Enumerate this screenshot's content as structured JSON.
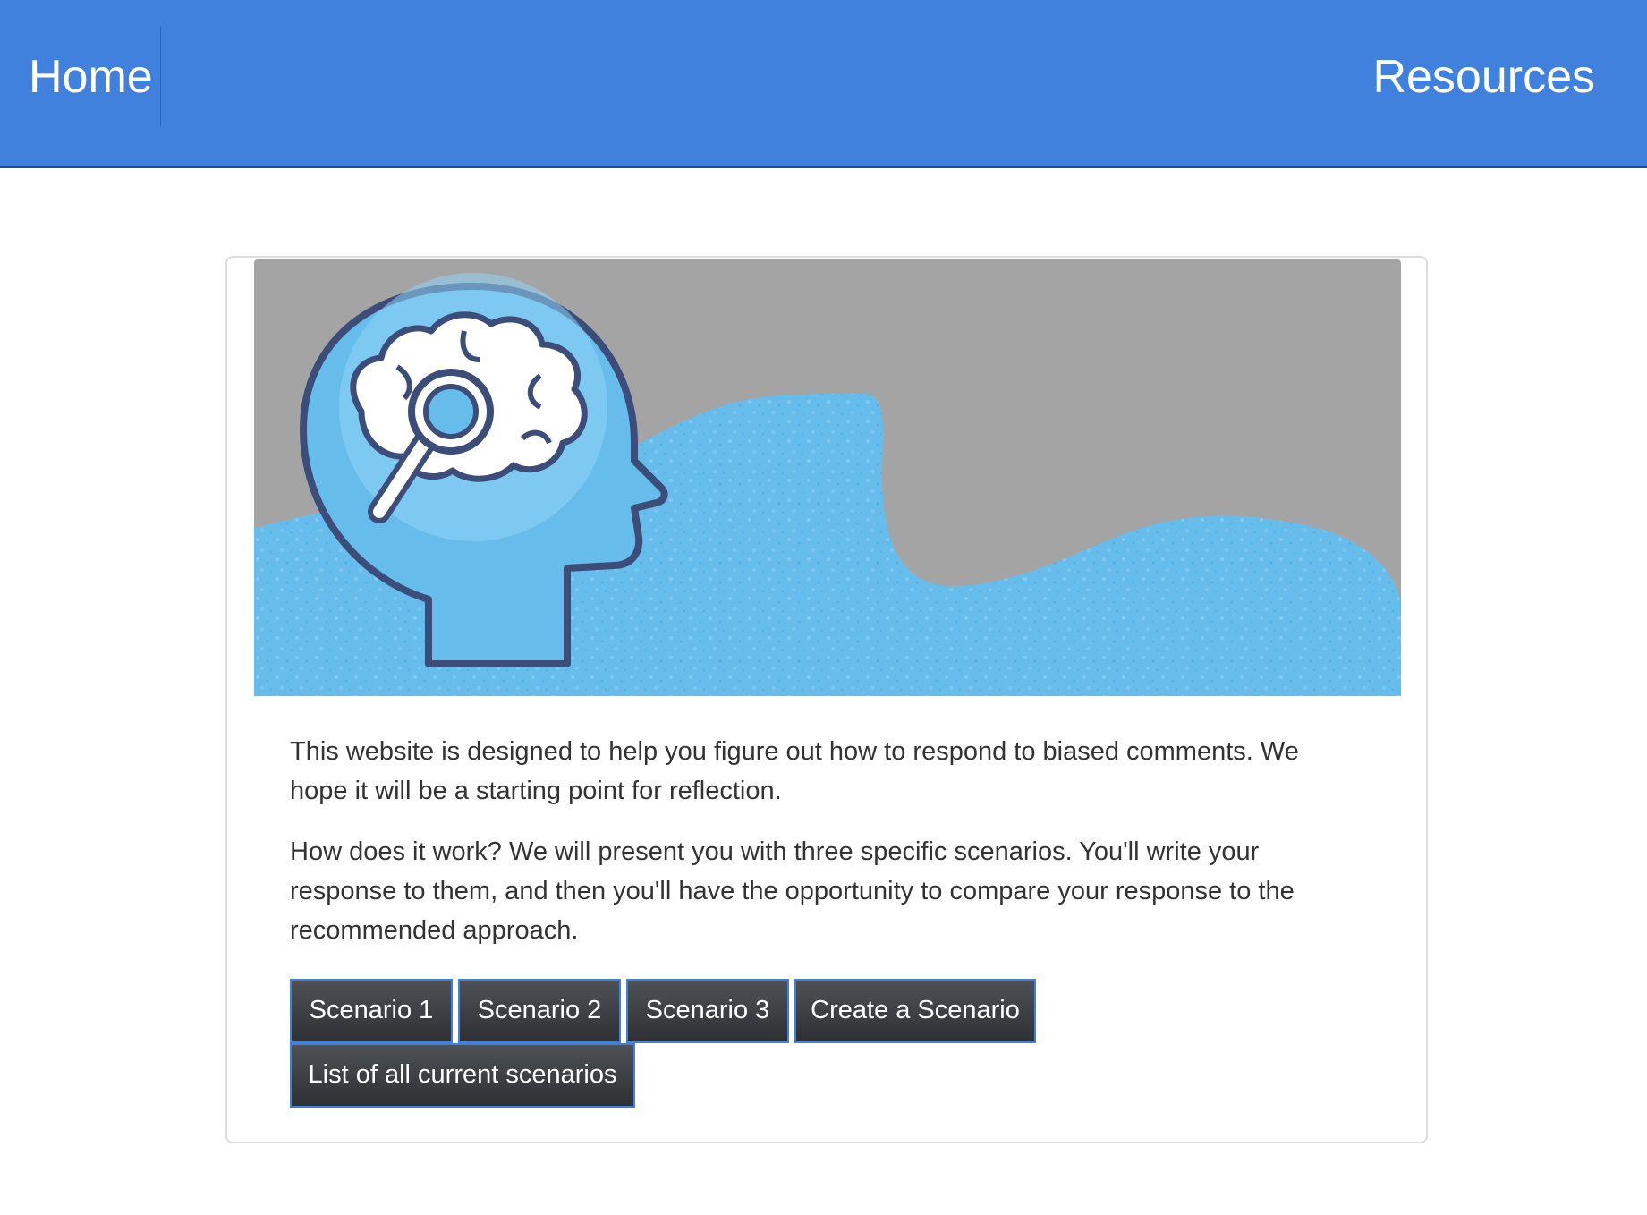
{
  "navbar": {
    "home_label": "Home",
    "resources_label": "Resources",
    "background_color": "#3f81dd"
  },
  "hero": {
    "image_name": "brain-magnifier-illustration",
    "colors": {
      "sky": "#a4a4a4",
      "wave": "#66bdec",
      "head": "#66bdec",
      "outline": "#3d4d7a"
    }
  },
  "intro": {
    "paragraph_1": "This website is designed to help you figure out how to respond to biased comments. We hope it will be a starting point for reflection.",
    "paragraph_2": "How does it work? We will present you with three specific scenarios. You'll write your response to them, and then you'll have the opportunity to compare your response to the recommended approach."
  },
  "buttons": {
    "scenario_1": "Scenario 1",
    "scenario_2": "Scenario 2",
    "scenario_3": "Scenario 3",
    "create_scenario": "Create a Scenario",
    "list_scenarios": "List of all current scenarios"
  }
}
